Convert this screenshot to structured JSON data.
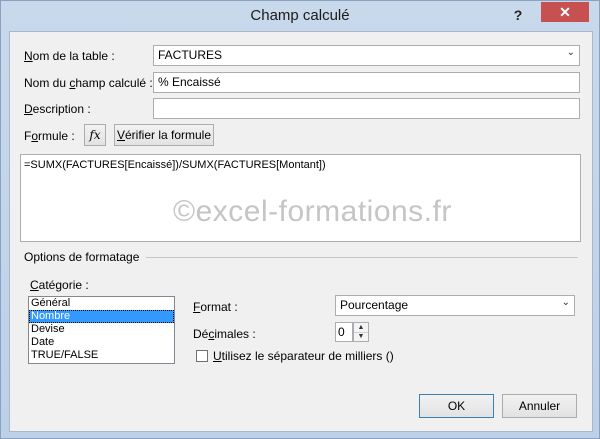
{
  "window": {
    "title": "Champ calculé",
    "help_glyph": "?",
    "close_glyph": "✕"
  },
  "labels": {
    "table_name_u": "N",
    "table_name_rest": "om de la table :",
    "calc_field_pre": "Nom du ",
    "calc_field_u": "c",
    "calc_field_rest": "hamp calculé :",
    "description_u": "D",
    "description_rest": "escription :",
    "formula_pre": "F",
    "formula_u": "o",
    "formula_rest": "rmule :",
    "formatting_options": "Options de formatage",
    "category_u": "C",
    "category_rest": "atégorie :",
    "format_u": "F",
    "format_rest": "ormat :",
    "decimals_pre": "Dé",
    "decimals_u": "c",
    "decimals_rest": "imales :",
    "thousands_u": "U",
    "thousands_rest": "tilisez le séparateur de milliers ()"
  },
  "fields": {
    "table_name": "FACTURES",
    "calc_field_name": "% Encaissé",
    "description": "",
    "formula": "=SUMX(FACTURES[Encaissé])/SUMX(FACTURES[Montant])",
    "format": "Pourcentage",
    "decimals": "0"
  },
  "buttons": {
    "fx": "fx",
    "verify_u": "V",
    "verify_rest": "érifier la formule",
    "ok": "OK",
    "cancel": "Annuler"
  },
  "categories": [
    "Général",
    "Nombre",
    "Devise",
    "Date",
    "TRUE/FALSE"
  ],
  "selected_category": "Nombre",
  "thousands_separator_checked": false,
  "watermark": "©excel-formations.fr",
  "icons": {
    "dropdown": "chevron-down-icon",
    "spin_up": "spin-up-icon",
    "spin_down": "spin-down-icon",
    "formula": "fx-icon"
  },
  "colors": {
    "selection": "#3399ff",
    "close_button": "#c75050",
    "title_bar": "#c9d9ec"
  }
}
